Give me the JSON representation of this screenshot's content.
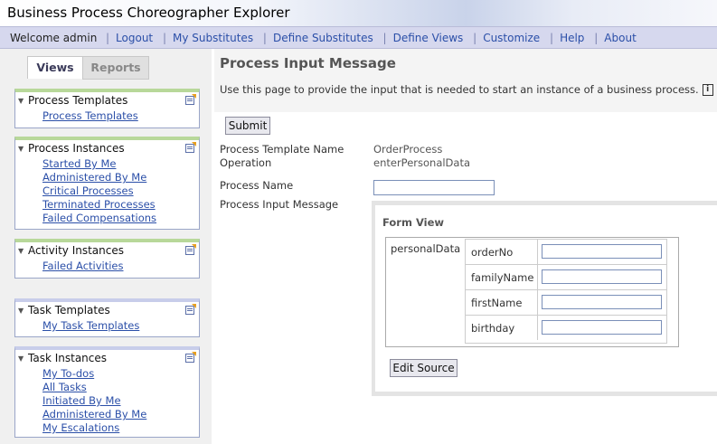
{
  "app": {
    "title": "Business Process Choreographer Explorer"
  },
  "nav": {
    "welcome": "Welcome admin",
    "links": [
      "Logout",
      "My Substitutes",
      "Define Substitutes",
      "Define Views",
      "Customize",
      "Help",
      "About"
    ]
  },
  "tabs": {
    "views": "Views",
    "reports": "Reports"
  },
  "sidebar": {
    "groups": [
      {
        "title": "Process Templates",
        "items": [
          "Process Templates"
        ]
      },
      {
        "title": "Process Instances",
        "items": [
          "Started By Me",
          "Administered By Me",
          "Critical Processes",
          "Terminated Processes",
          "Failed Compensations"
        ]
      },
      {
        "title": "Activity Instances",
        "items": [
          "Failed Activities"
        ]
      },
      {
        "title": "Task Templates",
        "items": [
          "My Task Templates"
        ]
      },
      {
        "title": "Task Instances",
        "items": [
          "My To-dos",
          "All Tasks",
          "Initiated By Me",
          "Administered By Me",
          "My Escalations"
        ]
      }
    ]
  },
  "page": {
    "heading": "Process Input Message",
    "description": "Use this page to provide the input that is needed to start an instance of a business process.",
    "info_glyph": "i",
    "submit": "Submit",
    "template_label": "Process Template Name",
    "template_value": "OrderProcess",
    "operation_label": "Operation",
    "operation_value": "enterPersonalData",
    "process_name_label": "Process Name",
    "process_name_value": "",
    "input_message_label": "Process Input Message",
    "form_view_title": "Form View",
    "personal_data_label": "personalData",
    "fields": [
      {
        "label": "orderNo",
        "value": ""
      },
      {
        "label": "familyName",
        "value": ""
      },
      {
        "label": "firstName",
        "value": ""
      },
      {
        "label": "birthday",
        "value": ""
      }
    ],
    "edit_source": "Edit Source"
  }
}
